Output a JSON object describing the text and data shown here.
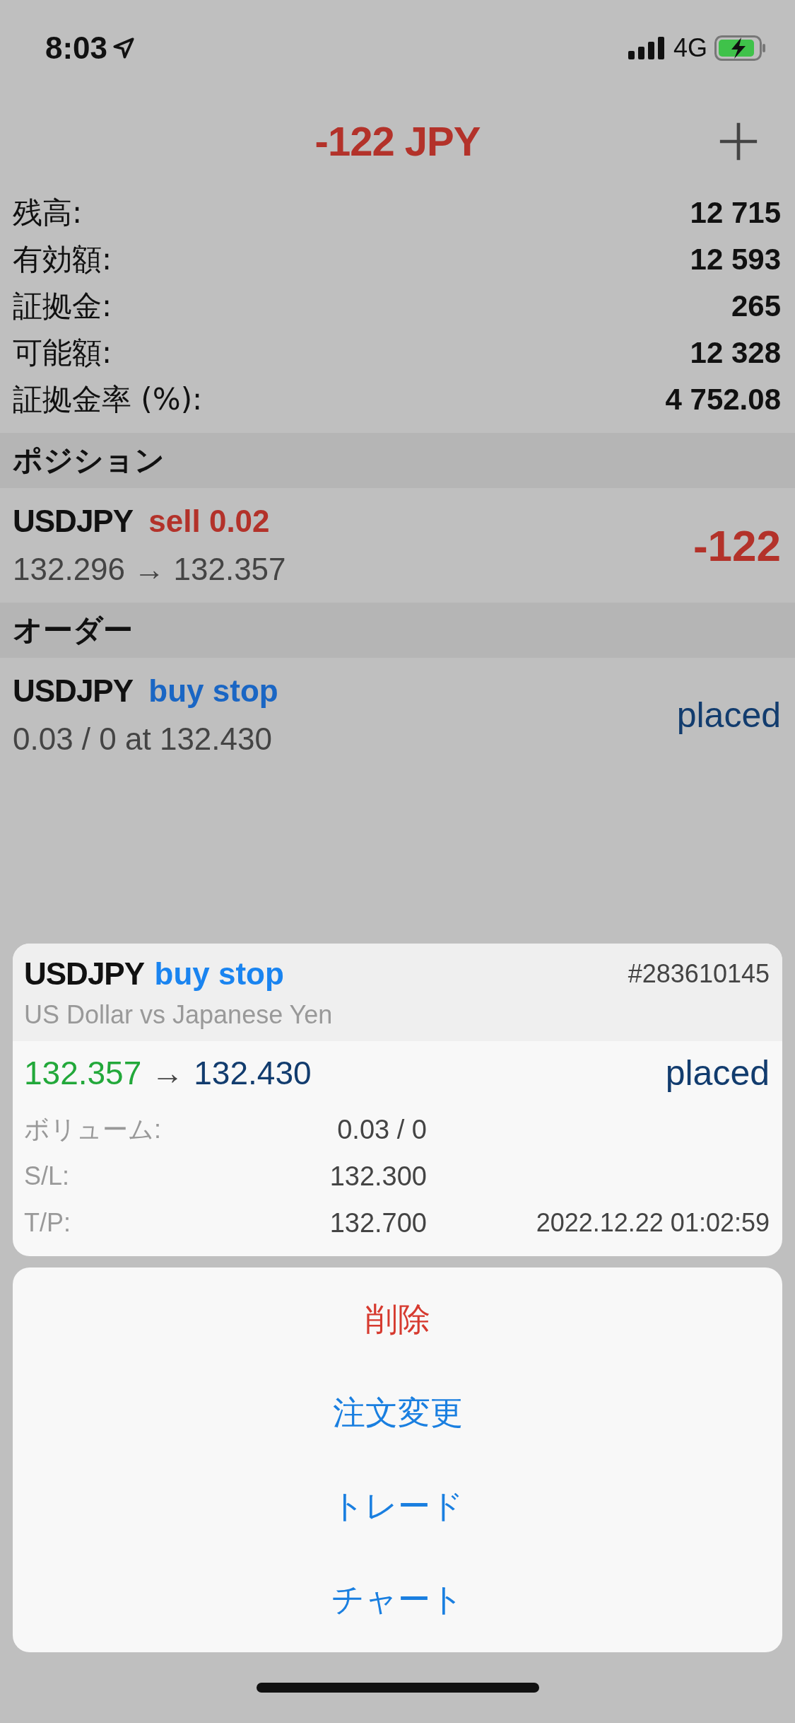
{
  "status_bar": {
    "time": "8:03",
    "network": "4G"
  },
  "header": {
    "title": "-122 JPY"
  },
  "account": [
    {
      "label": "残高:",
      "value": "12 715"
    },
    {
      "label": "有効額:",
      "value": "12 593"
    },
    {
      "label": "証拠金:",
      "value": "265"
    },
    {
      "label": "可能額:",
      "value": "12 328"
    },
    {
      "label": "証拠金率 (%):",
      "value": "4 752.08"
    }
  ],
  "positions": {
    "title": "ポジション",
    "items": [
      {
        "symbol": "USDJPY",
        "action": "sell 0.02",
        "kind": "sell",
        "detail": "132.296 → 132.357",
        "profit": "-122"
      }
    ]
  },
  "orders": {
    "title": "オーダー",
    "items": [
      {
        "symbol": "USDJPY",
        "action": "buy stop",
        "kind": "buy",
        "detail": "0.03 / 0 at 132.430",
        "status": "placed"
      }
    ]
  },
  "detail_card": {
    "symbol": "USDJPY",
    "action": "buy stop",
    "kind": "buy",
    "ticket": "#283610145",
    "description": "US Dollar vs Japanese Yen",
    "price_from": "132.357",
    "arrow": "→",
    "price_to": "132.430",
    "status": "placed",
    "fields": [
      {
        "label": "ボリューム:",
        "value": "0.03 / 0"
      },
      {
        "label": "S/L:",
        "value": "132.300"
      },
      {
        "label": "T/P:",
        "value": "132.700",
        "extra": "2022.12.22 01:02:59"
      }
    ]
  },
  "action_sheet": [
    {
      "label": "削除",
      "kind": "destructive"
    },
    {
      "label": "注文変更",
      "kind": "default"
    },
    {
      "label": "トレード",
      "kind": "default"
    },
    {
      "label": "チャート",
      "kind": "default"
    }
  ]
}
